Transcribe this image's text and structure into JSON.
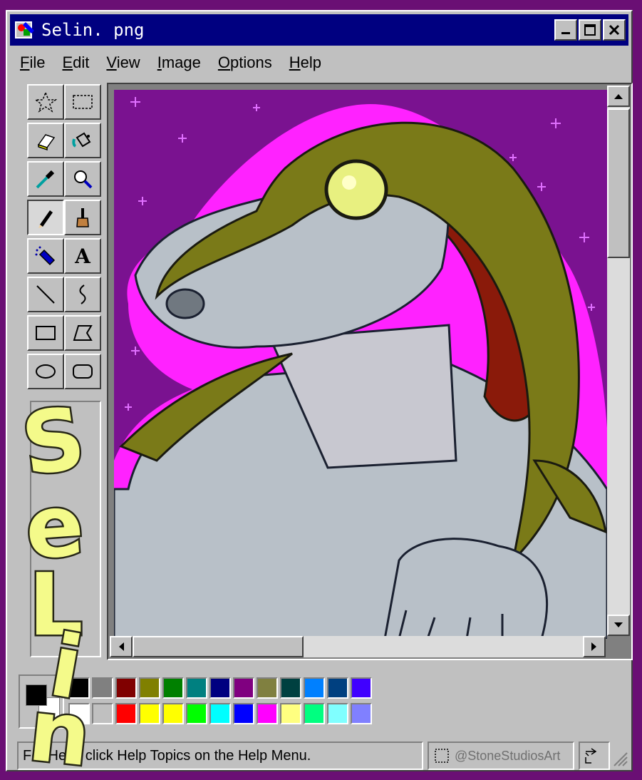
{
  "window": {
    "title": "Selin. png",
    "controls": [
      "minimize",
      "maximize",
      "close"
    ]
  },
  "menu": {
    "items": [
      {
        "label": "File",
        "underline": "F"
      },
      {
        "label": "Edit",
        "underline": "E"
      },
      {
        "label": "View",
        "underline": "V"
      },
      {
        "label": "Image",
        "underline": "I"
      },
      {
        "label": "Options",
        "underline": "O"
      },
      {
        "label": "Help",
        "underline": "H"
      }
    ]
  },
  "tools": [
    {
      "name": "free-form-select",
      "icon": "star-select-icon"
    },
    {
      "name": "select",
      "icon": "rect-select-icon"
    },
    {
      "name": "eraser",
      "icon": "eraser-icon"
    },
    {
      "name": "fill",
      "icon": "fill-bucket-icon"
    },
    {
      "name": "pick-color",
      "icon": "eyedropper-icon"
    },
    {
      "name": "magnifier",
      "icon": "magnifier-icon"
    },
    {
      "name": "pencil",
      "icon": "pencil-icon",
      "active": true
    },
    {
      "name": "brush",
      "icon": "brush-icon"
    },
    {
      "name": "airbrush",
      "icon": "airbrush-icon"
    },
    {
      "name": "text",
      "icon": "text-icon",
      "glyph": "A"
    },
    {
      "name": "line",
      "icon": "line-icon"
    },
    {
      "name": "curve",
      "icon": "curve-icon"
    },
    {
      "name": "rectangle",
      "icon": "rectangle-icon"
    },
    {
      "name": "polygon",
      "icon": "polygon-icon"
    },
    {
      "name": "ellipse",
      "icon": "ellipse-icon"
    },
    {
      "name": "rounded-rectangle",
      "icon": "rounded-rect-icon"
    }
  ],
  "colors": {
    "foreground": "#000000",
    "background": "#ffffff",
    "palette_top": [
      "#000000",
      "#808080",
      "#800000",
      "#808000",
      "#008000",
      "#008080",
      "#000080",
      "#800080",
      "#808040",
      "#004040",
      "#0080ff",
      "#004080",
      "#4000ff"
    ],
    "palette_bottom": [
      "#ffffff",
      "#c0c0c0",
      "#ff0000",
      "#ffff00",
      "#ffff00",
      "#00ff00",
      "#00ffff",
      "#0000ff",
      "#ff00ff",
      "#ffff80",
      "#00ff80",
      "#80ffff",
      "#8080ff"
    ],
    "canvas_background": "#7a1290",
    "outline_accent": "#ff22ff",
    "hair_green": "#7a7a18",
    "mane_red": "#8a1a0a",
    "skin": "#b8c0c8"
  },
  "status": {
    "help_text": "For Help, click Help Topics on the Help Menu.",
    "credit": "@StoneStudiosArt"
  },
  "signature": {
    "text": "Selin",
    "letters": [
      "S",
      "e",
      "L",
      "i",
      "n"
    ]
  }
}
